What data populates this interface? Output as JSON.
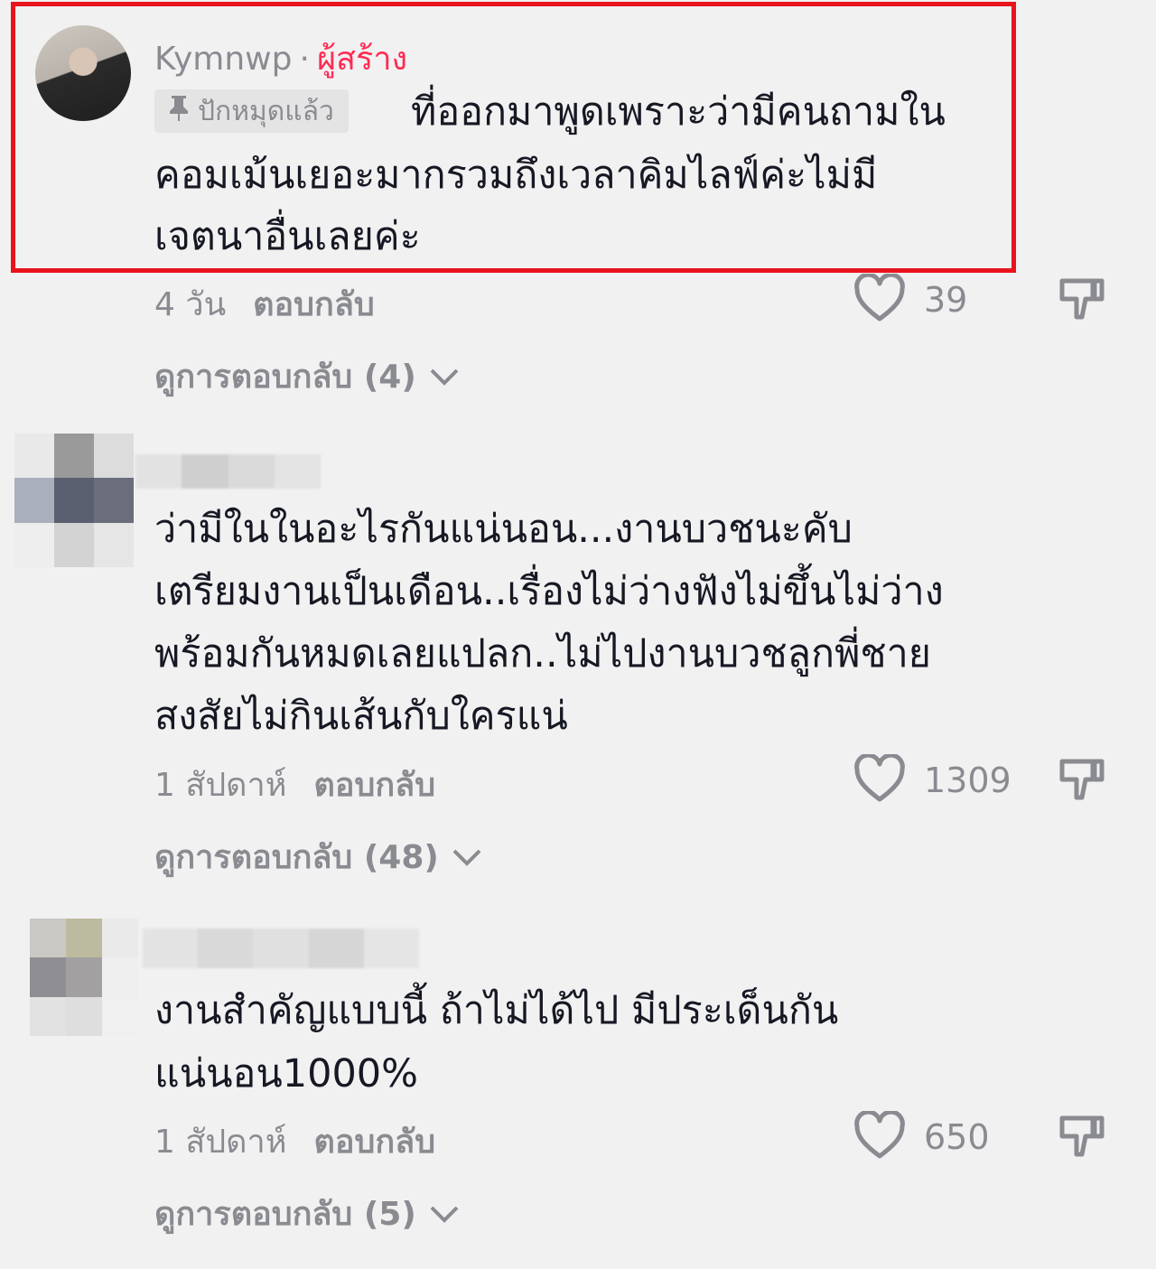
{
  "comments": [
    {
      "username": "Kymnwp",
      "separator": "·",
      "creator_label": "ผู้สร้าง",
      "pinned_label": "ปักหมุดแล้ว",
      "text_lines": [
        "ที่ออกมาพูดเพราะว่ามีคนถามใน",
        "คอมเม้นเยอะมากรวมถึงเวลาคิมไลฟ์ค่ะไม่มี",
        "เจตนาอื่นเลยค่ะ"
      ],
      "time": "4 วัน",
      "reply_label": "ตอบกลับ",
      "likes": "39",
      "view_replies": "ดูการตอบกลับ (4)"
    },
    {
      "text_lines": [
        "ว่ามีในในอะไรกันแน่นอน...งานบวชนะคับ",
        "เตรียมงานเป็นเดือน..เรื่องไม่ว่างฟังไม่ขึ้นไม่ว่าง",
        "พร้อมกันหมดเลยแปลก..ไม่ไปงานบวชลูกพี่ชาย",
        "สงสัยไม่กินเส้นกับใครแน่"
      ],
      "time": "1 สัปดาห์",
      "reply_label": "ตอบกลับ",
      "likes": "1309",
      "view_replies": "ดูการตอบกลับ (48)"
    },
    {
      "text_lines": [
        "งานสำคัญแบบนี้ ถ้าไม่ได้ไป มีประเด็นกัน",
        "แน่นอน1000%"
      ],
      "time": "1 สัปดาห์",
      "reply_label": "ตอบกลับ",
      "likes": "650",
      "view_replies": "ดูการตอบกลับ (5)"
    }
  ],
  "colors": {
    "accent": "#fe2c55",
    "highlight_border": "#e8141c",
    "muted": "#8a8b91",
    "text": "#161823"
  },
  "icons": [
    "pin-icon",
    "heart-icon",
    "dislike-icon",
    "chevron-down-icon"
  ]
}
